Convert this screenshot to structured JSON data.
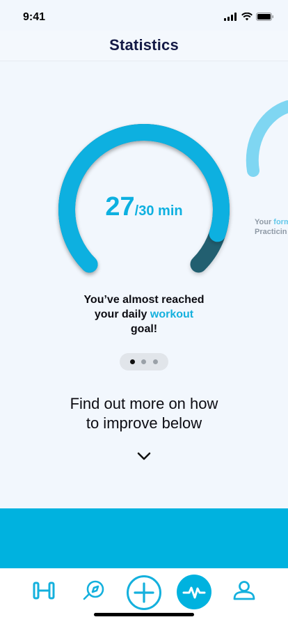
{
  "status": {
    "time": "9:41"
  },
  "header": {
    "title": "Statistics"
  },
  "gauge": {
    "value": "27",
    "unit": "/30 min",
    "progress_fraction": 0.9,
    "message_pre": "You’ve almost reached",
    "message_line2_pre": "your daily ",
    "message_highlight": "workout",
    "message_post": "goal!"
  },
  "next_card_peek": {
    "line1_pre": "Your ",
    "line1_highlight": "form",
    "line2": "Practicin"
  },
  "pager": {
    "pages": 3,
    "active": 0
  },
  "more": {
    "line1": "Find out more on how",
    "line2": "to improve below"
  },
  "tabs": [
    {
      "name": "workouts-tab",
      "icon": "dumbbell-icon"
    },
    {
      "name": "explore-tab",
      "icon": "compass-icon"
    },
    {
      "name": "add-tab",
      "icon": "plus-circle-icon"
    },
    {
      "name": "statistics-tab",
      "icon": "activity-icon",
      "active": true
    },
    {
      "name": "profile-tab",
      "icon": "user-icon"
    }
  ],
  "colors": {
    "accent": "#0db0e0",
    "gauge_remaining": "#235f70",
    "title": "#141a46",
    "panel": "#00b2df"
  }
}
